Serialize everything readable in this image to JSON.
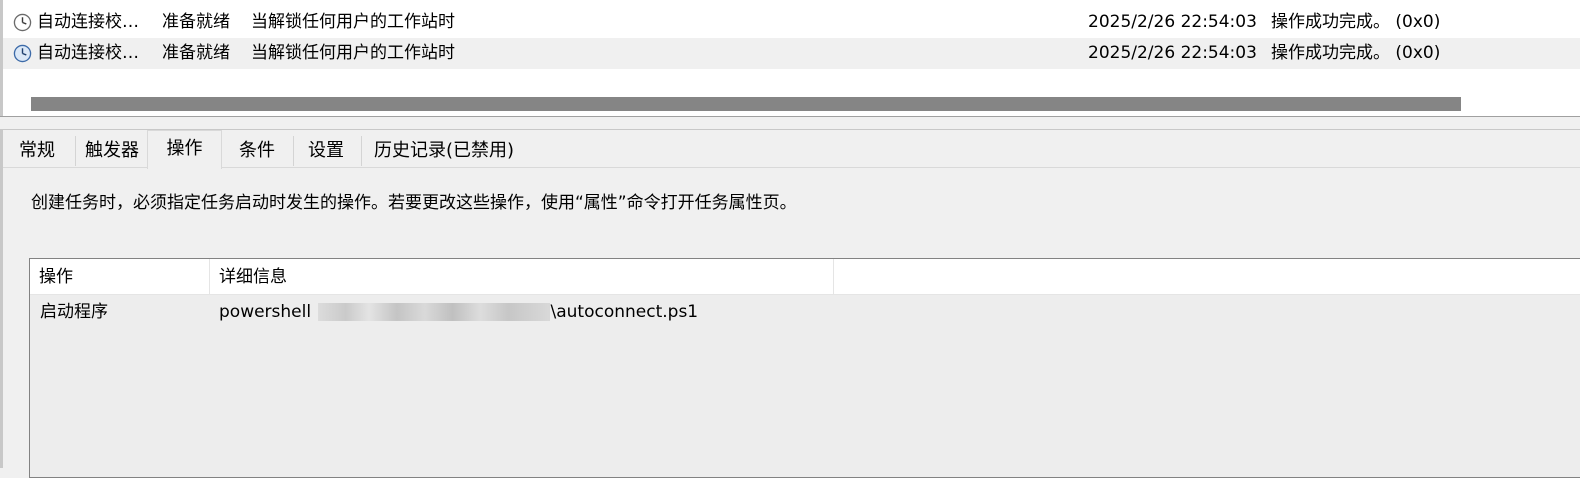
{
  "task_list": {
    "rows": [
      {
        "name": "自动连接校…",
        "status": "准备就绪",
        "trigger": "当解锁任何用户的工作站时",
        "last_run": "2025/2/26 22:54:03",
        "result": "操作成功完成。 (0x0)"
      },
      {
        "name": "自动连接校…",
        "status": "准备就绪",
        "trigger": "当解锁任何用户的工作站时",
        "last_run": "2025/2/26 22:54:03",
        "result": "操作成功完成。 (0x0)"
      }
    ],
    "row_icon": "clock-icon"
  },
  "tabs": [
    {
      "label": "常规",
      "active": false
    },
    {
      "label": "触发器",
      "active": false
    },
    {
      "label": "操作",
      "active": true
    },
    {
      "label": "条件",
      "active": false
    },
    {
      "label": "设置",
      "active": false
    },
    {
      "label": "历史记录(已禁用)",
      "active": false
    }
  ],
  "actions_tab": {
    "description": "创建任务时，必须指定任务启动时发生的操作。若要更改这些操作，使用“属性”命令打开任务属性页。",
    "columns": [
      "操作",
      "详细信息"
    ],
    "rows": [
      {
        "action": "启动程序",
        "detail_prefix": "powershell",
        "detail_suffix": "\\autoconnect.ps1"
      }
    ]
  },
  "colors": {
    "selected_row": "#f0f0f0",
    "scrollbar_thumb": "#858585",
    "panel_background": "#f0f0f0"
  }
}
